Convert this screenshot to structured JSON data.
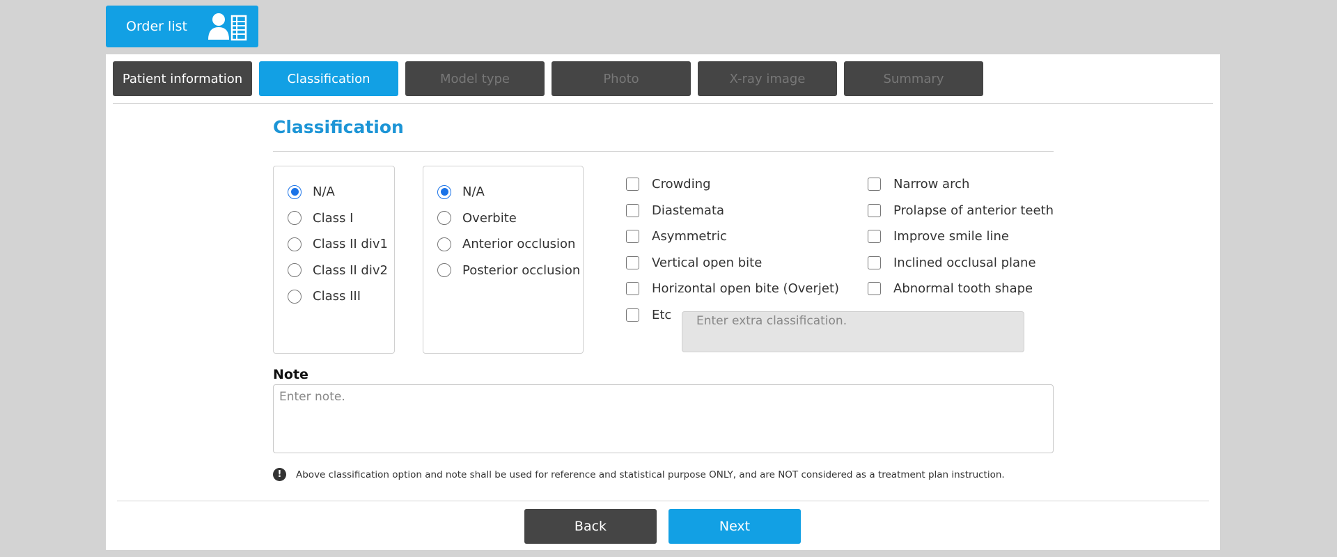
{
  "header": {
    "order_list_label": "Order list",
    "order_list_icon": "user-list-icon"
  },
  "tabs": [
    {
      "label": "Patient information",
      "state": "done"
    },
    {
      "label": "Classification",
      "state": "active"
    },
    {
      "label": "Model type",
      "state": "disabled"
    },
    {
      "label": "Photo",
      "state": "disabled"
    },
    {
      "label": "X-ray image",
      "state": "disabled"
    },
    {
      "label": "Summary",
      "state": "disabled"
    }
  ],
  "section_title": "Classification",
  "molar_class": {
    "selected": "N/A",
    "options": [
      "N/A",
      "Class I",
      "Class II div1",
      "Class II div2",
      "Class III"
    ]
  },
  "occlusion": {
    "selected": "N/A",
    "options": [
      "N/A",
      "Overbite",
      "Anterior occlusion",
      "Posterior occlusion"
    ]
  },
  "checkboxes_left": [
    {
      "label": "Crowding",
      "checked": false
    },
    {
      "label": "Diastemata",
      "checked": false
    },
    {
      "label": "Asymmetric",
      "checked": false
    },
    {
      "label": "Vertical open bite",
      "checked": false
    },
    {
      "label": "Horizontal open bite (Overjet)",
      "checked": false
    },
    {
      "label": "Etc",
      "checked": false
    }
  ],
  "checkboxes_right": [
    {
      "label": "Narrow arch",
      "checked": false
    },
    {
      "label": "Prolapse of anterior teeth",
      "checked": false
    },
    {
      "label": "Improve smile line",
      "checked": false
    },
    {
      "label": "Inclined occlusal plane",
      "checked": false
    },
    {
      "label": "Abnormal tooth shape",
      "checked": false
    }
  ],
  "etc_input": {
    "placeholder": "Enter extra classification.",
    "value": ""
  },
  "note": {
    "label": "Note",
    "placeholder": "Enter note.",
    "value": ""
  },
  "notice": {
    "icon": "exclamation-icon",
    "text": "Above classification option and note shall be used for reference and statistical purpose ONLY, and are NOT considered as a treatment plan instruction."
  },
  "footer": {
    "back_label": "Back",
    "next_label": "Next"
  },
  "colors": {
    "accent": "#12a0e4",
    "dark": "#454545",
    "radio": "#1a73e8",
    "title": "#1d95d6"
  }
}
